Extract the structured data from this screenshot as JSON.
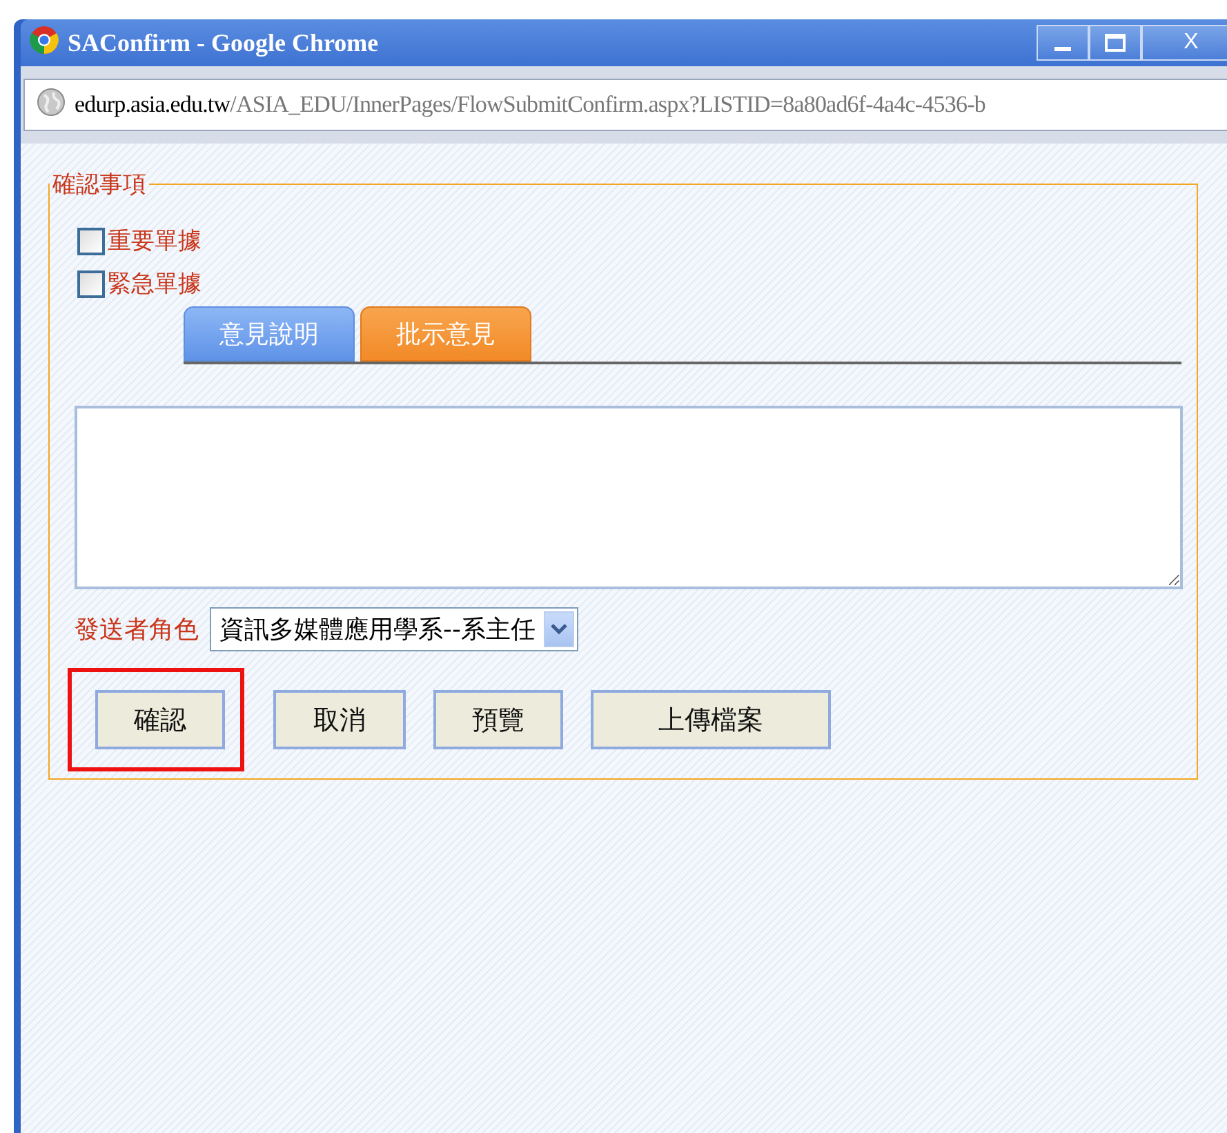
{
  "window": {
    "title": "SAConfirm - Google Chrome",
    "controls": [
      {
        "kind": "minimize"
      },
      {
        "kind": "maximize"
      },
      {
        "kind": "close",
        "label": "X"
      }
    ]
  },
  "address_bar": {
    "host": "edurp.asia.edu.tw",
    "path": "/ASIA_EDU/InnerPages/FlowSubmitConfirm.aspx?LISTID=8a80ad6f-4a4c-4536-b"
  },
  "fieldset": {
    "legend": "確認事項"
  },
  "checkboxes": [
    {
      "label": "重要單據",
      "checked": false
    },
    {
      "label": "緊急單據",
      "checked": false
    }
  ],
  "tabs": [
    {
      "label": "意見說明",
      "selected": false
    },
    {
      "label": "批示意見",
      "selected": true
    }
  ],
  "sender_role": {
    "label": "發送者角色",
    "value": "資訊多媒體應用學系--系主任"
  },
  "buttons": [
    {
      "label": "確認",
      "highlighted": true
    },
    {
      "label": "取消",
      "highlighted": false
    },
    {
      "label": "預覽",
      "highlighted": false
    },
    {
      "label": "上傳檔案",
      "highlighted": false
    }
  ]
}
